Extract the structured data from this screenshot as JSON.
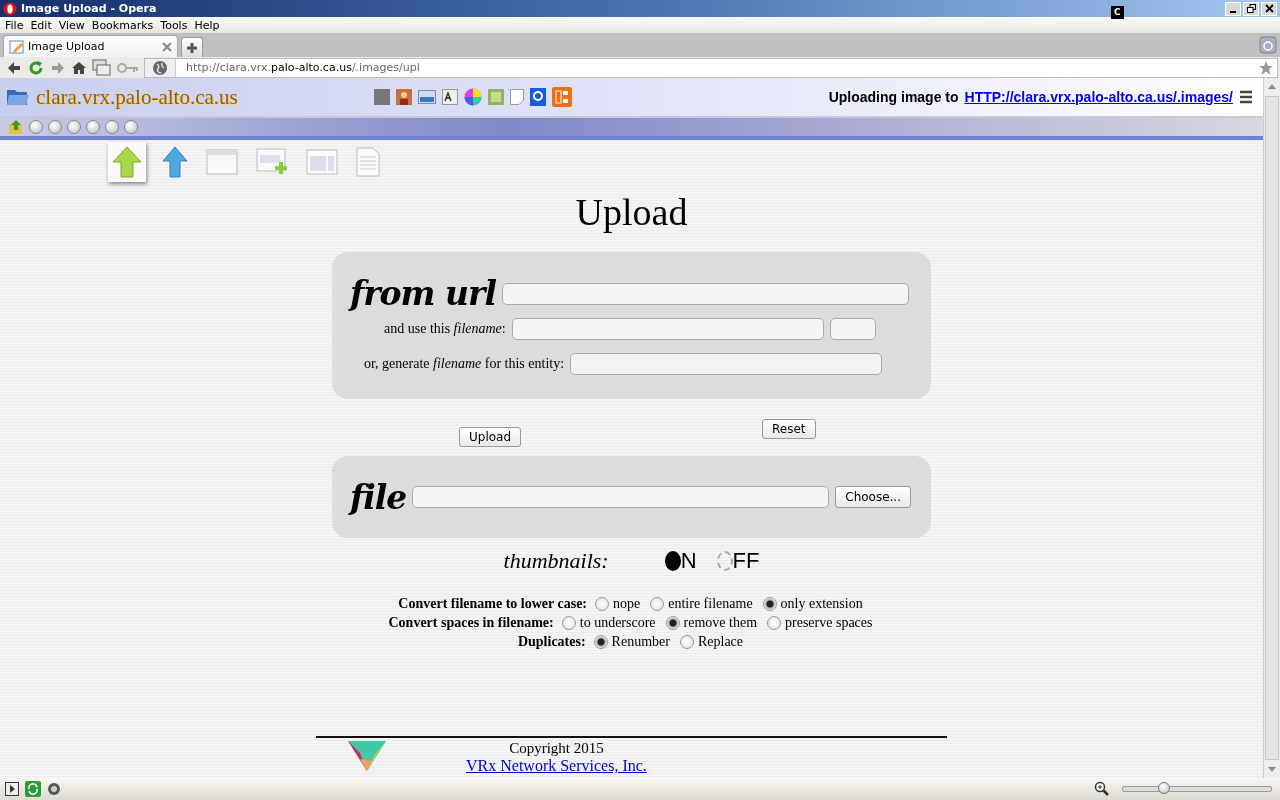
{
  "window": {
    "title": "Image Upload - Opera",
    "badge": "C"
  },
  "menu": [
    "File",
    "Edit",
    "View",
    "Bookmarks",
    "Tools",
    "Help"
  ],
  "tabs": [
    {
      "label": "Image Upload",
      "selected": true
    }
  ],
  "address": {
    "prefix": "http://clara.vrx.",
    "domain": "palo-alto.ca.us",
    "suffix": "/.images/upl"
  },
  "site": {
    "name": "clara.vrx.palo-alto.ca.us",
    "status_label": "Uploading image to",
    "status_link": "HTTP://clara.vrx.palo-alto.ca.us/.images/"
  },
  "page_tabs": [
    {
      "kind": "upload",
      "selected": true
    },
    {
      "kind": "arrow",
      "selected": false
    },
    {
      "kind": "window",
      "selected": false
    },
    {
      "kind": "window-add",
      "selected": false
    },
    {
      "kind": "layout",
      "selected": false
    },
    {
      "kind": "document",
      "selected": false
    }
  ],
  "heading": "Upload",
  "url_panel": {
    "title": "from url",
    "filename_label": "and use this *filename*:",
    "entity_label": "or, generate *filename* for this entity:"
  },
  "buttons": {
    "upload": "Upload",
    "reset": "Reset"
  },
  "file_panel": {
    "title": "file",
    "choose": "Choose..."
  },
  "thumbnails": {
    "label": "thumbnails:",
    "options": [
      {
        "label": "N",
        "selected": true
      },
      {
        "label": "FF",
        "selected": false
      }
    ]
  },
  "option_groups": [
    {
      "label": "Convert filename to lower case:",
      "options": [
        {
          "label": "nope",
          "selected": false
        },
        {
          "label": "entire filename",
          "selected": false
        },
        {
          "label": "only extension",
          "selected": true
        }
      ]
    },
    {
      "label": "Convert spaces in filename:",
      "options": [
        {
          "label": "to underscore",
          "selected": false
        },
        {
          "label": "remove them",
          "selected": true
        },
        {
          "label": "preserve spaces",
          "selected": false
        }
      ]
    },
    {
      "label": "Duplicates:",
      "options": [
        {
          "label": "Renumber",
          "selected": true
        },
        {
          "label": "Replace",
          "selected": false
        }
      ]
    }
  ],
  "footer": {
    "copyright": "Copyright 2015",
    "link": "VRx Network Services, Inc."
  },
  "status_bar": {
    "zoom": {
      "level": 0.28
    }
  }
}
